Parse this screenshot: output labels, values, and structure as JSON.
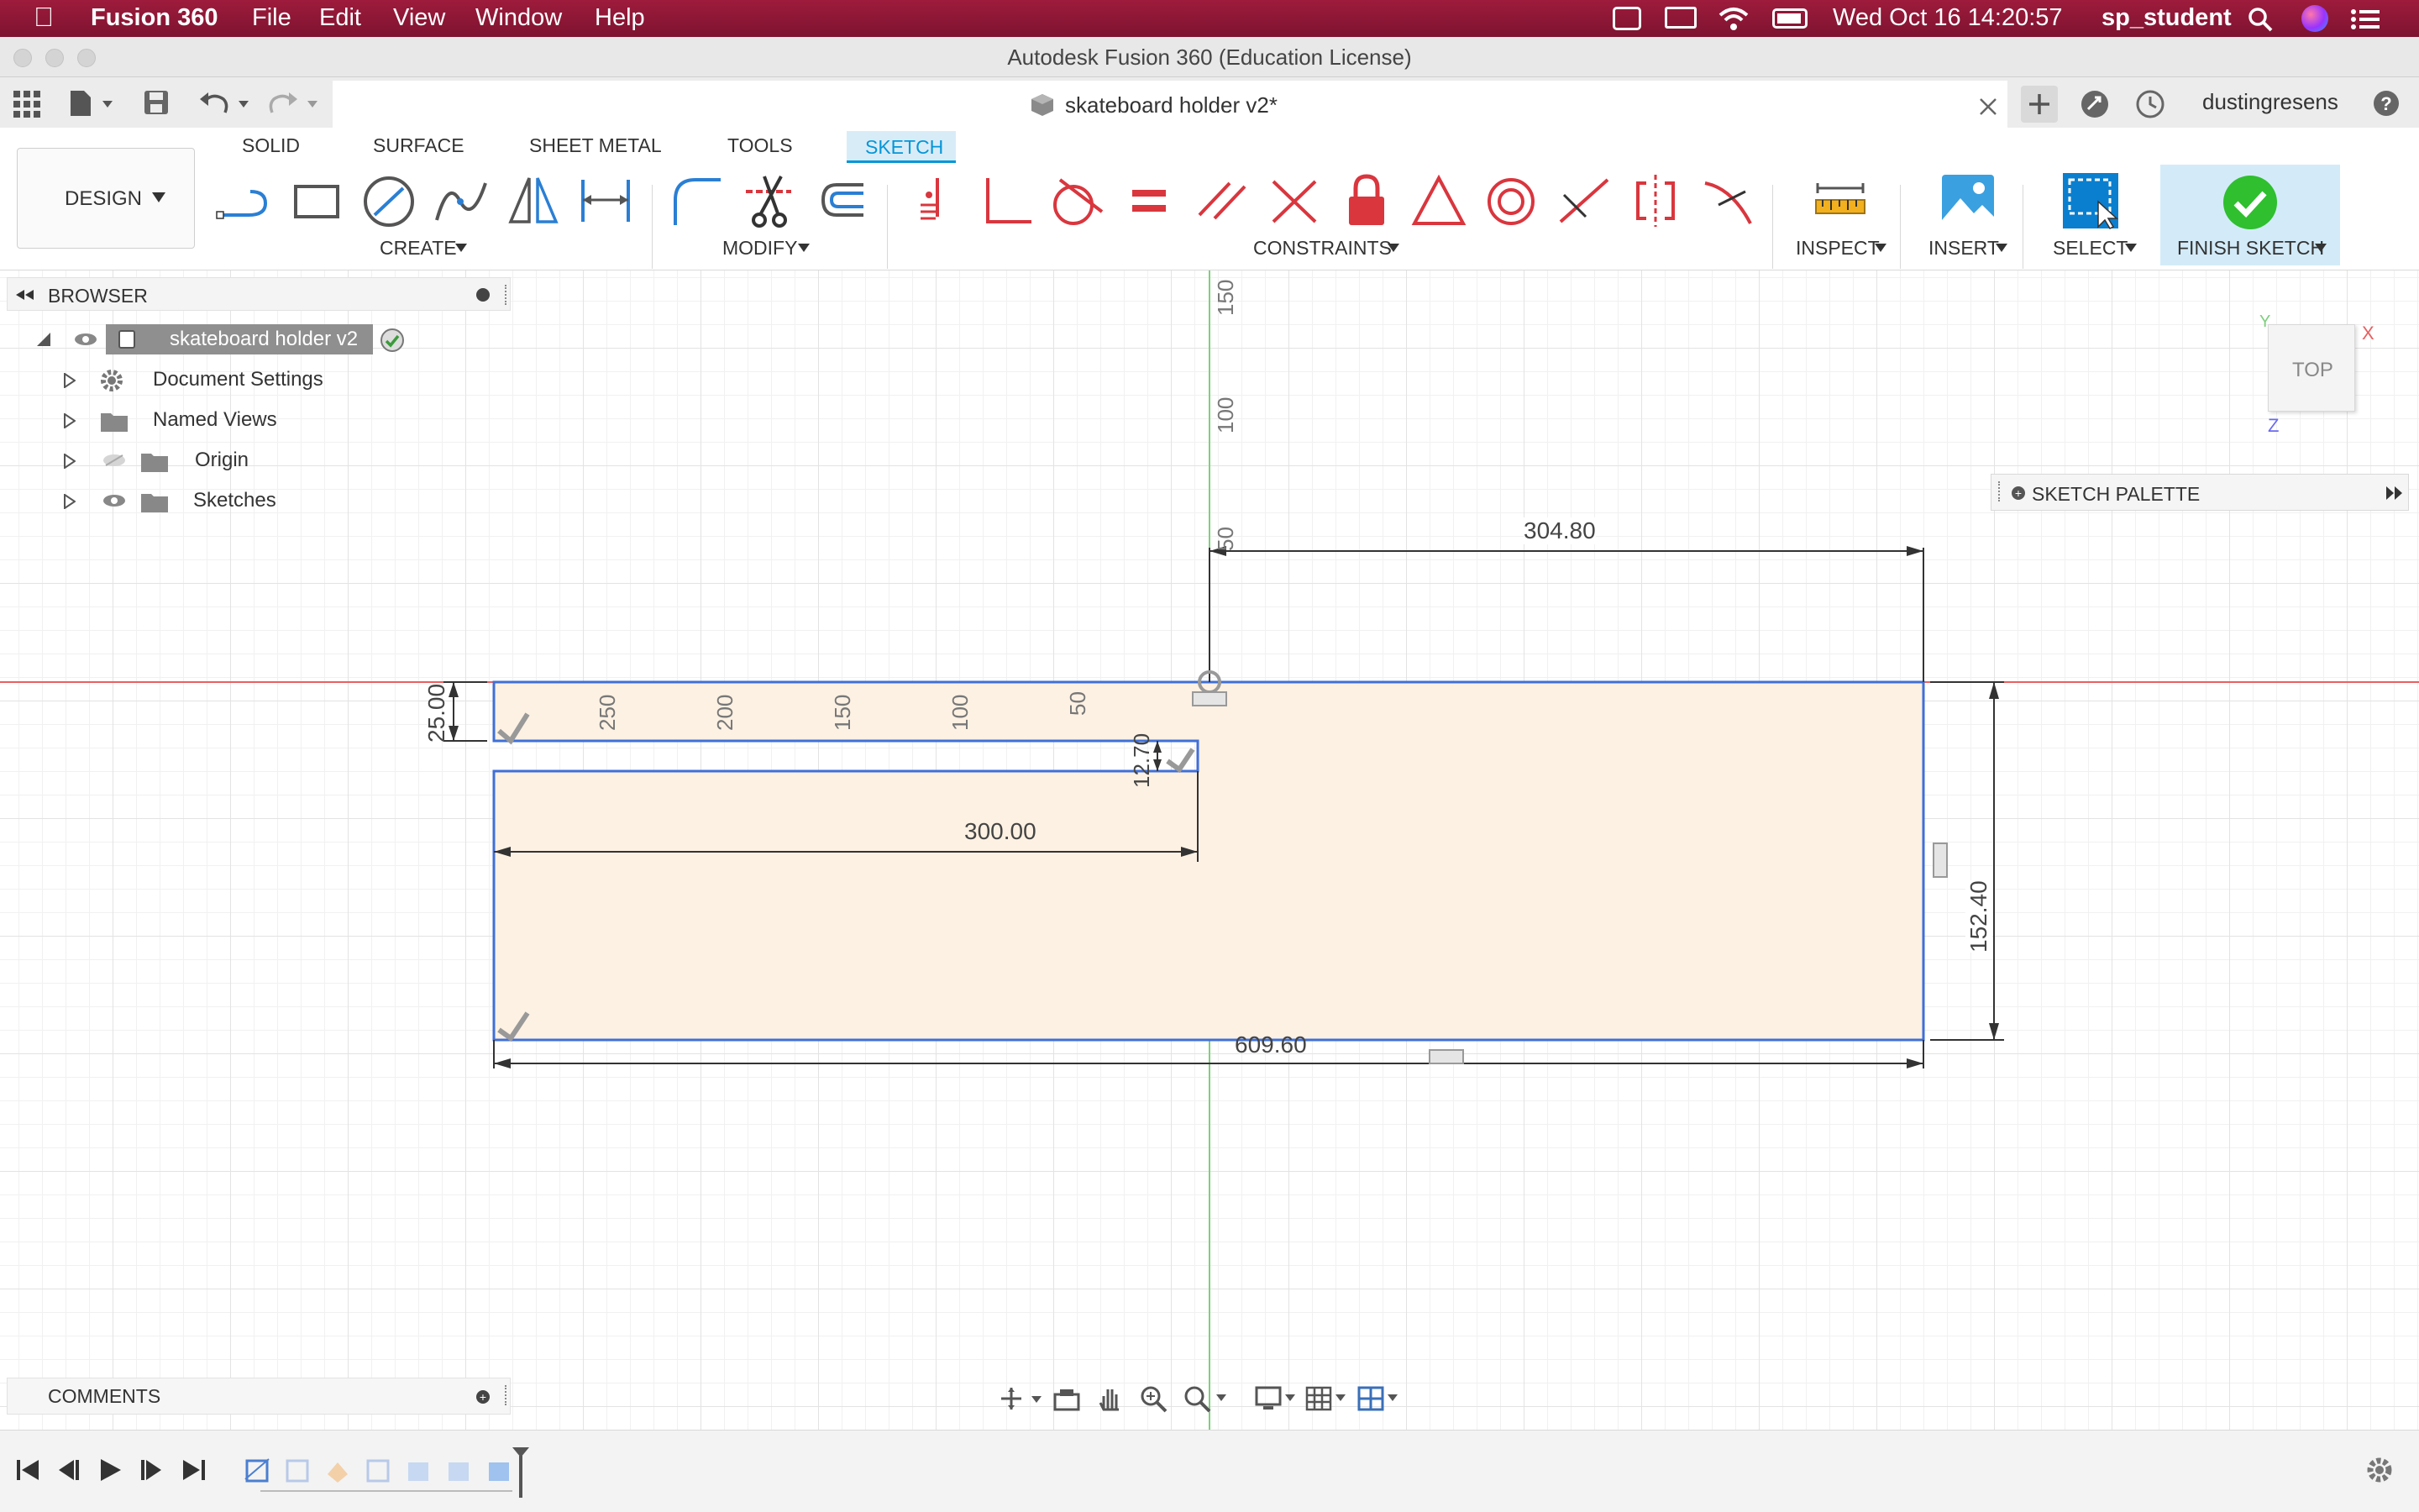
{
  "menubar": {
    "app_name": "Fusion 360",
    "menus": [
      "File",
      "Edit",
      "View",
      "Window",
      "Help"
    ],
    "clock": "Wed Oct 16  14:20:57",
    "user": "sp_student"
  },
  "window": {
    "title": "Autodesk Fusion 360 (Education License)"
  },
  "document_tab": {
    "title": "skateboard holder v2*",
    "user": "dustingresens"
  },
  "ribbon": {
    "workspace": "DESIGN",
    "tabs": [
      "SOLID",
      "SURFACE",
      "SHEET METAL",
      "TOOLS",
      "SKETCH"
    ],
    "active_tab": "SKETCH",
    "groups": {
      "create": "CREATE",
      "modify": "MODIFY",
      "constraints": "CONSTRAINTS",
      "inspect": "INSPECT",
      "insert": "INSERT",
      "select": "SELECT",
      "finish": "FINISH SKETCH"
    }
  },
  "browser": {
    "title": "BROWSER",
    "root": "skateboard holder v2",
    "items": [
      {
        "label": "Document Settings",
        "icon": "gear-icon"
      },
      {
        "label": "Named Views",
        "icon": "folder-icon"
      },
      {
        "label": "Origin",
        "icon": "folder-icon"
      },
      {
        "label": "Sketches",
        "icon": "folder-icon"
      }
    ]
  },
  "sketch_palette": {
    "title": "SKETCH PALETTE"
  },
  "viewcube": {
    "face": "TOP",
    "axis_x": "X",
    "axis_y": "Y",
    "axis_z": "Z"
  },
  "sketch": {
    "dimensions": {
      "top_width": "304.80",
      "left_height": "25.00",
      "slot_height": "12.70",
      "slot_length": "300.00",
      "overall_length": "609.60",
      "right_height": "152.40"
    },
    "ruler_vertical": [
      "150",
      "100",
      "50"
    ],
    "ruler_horizontal": [
      "250",
      "200",
      "150",
      "100",
      "50"
    ]
  },
  "comments": {
    "title": "COMMENTS"
  },
  "colors": {
    "menubar": "#8b1535",
    "accent": "#0696d7",
    "sketch_fill": "#fdf1e3",
    "sketch_line": "#3f6fd8",
    "x_axis": "#e86060",
    "y_axis": "#7fcf7f",
    "constraint_red": "#d9363e"
  }
}
